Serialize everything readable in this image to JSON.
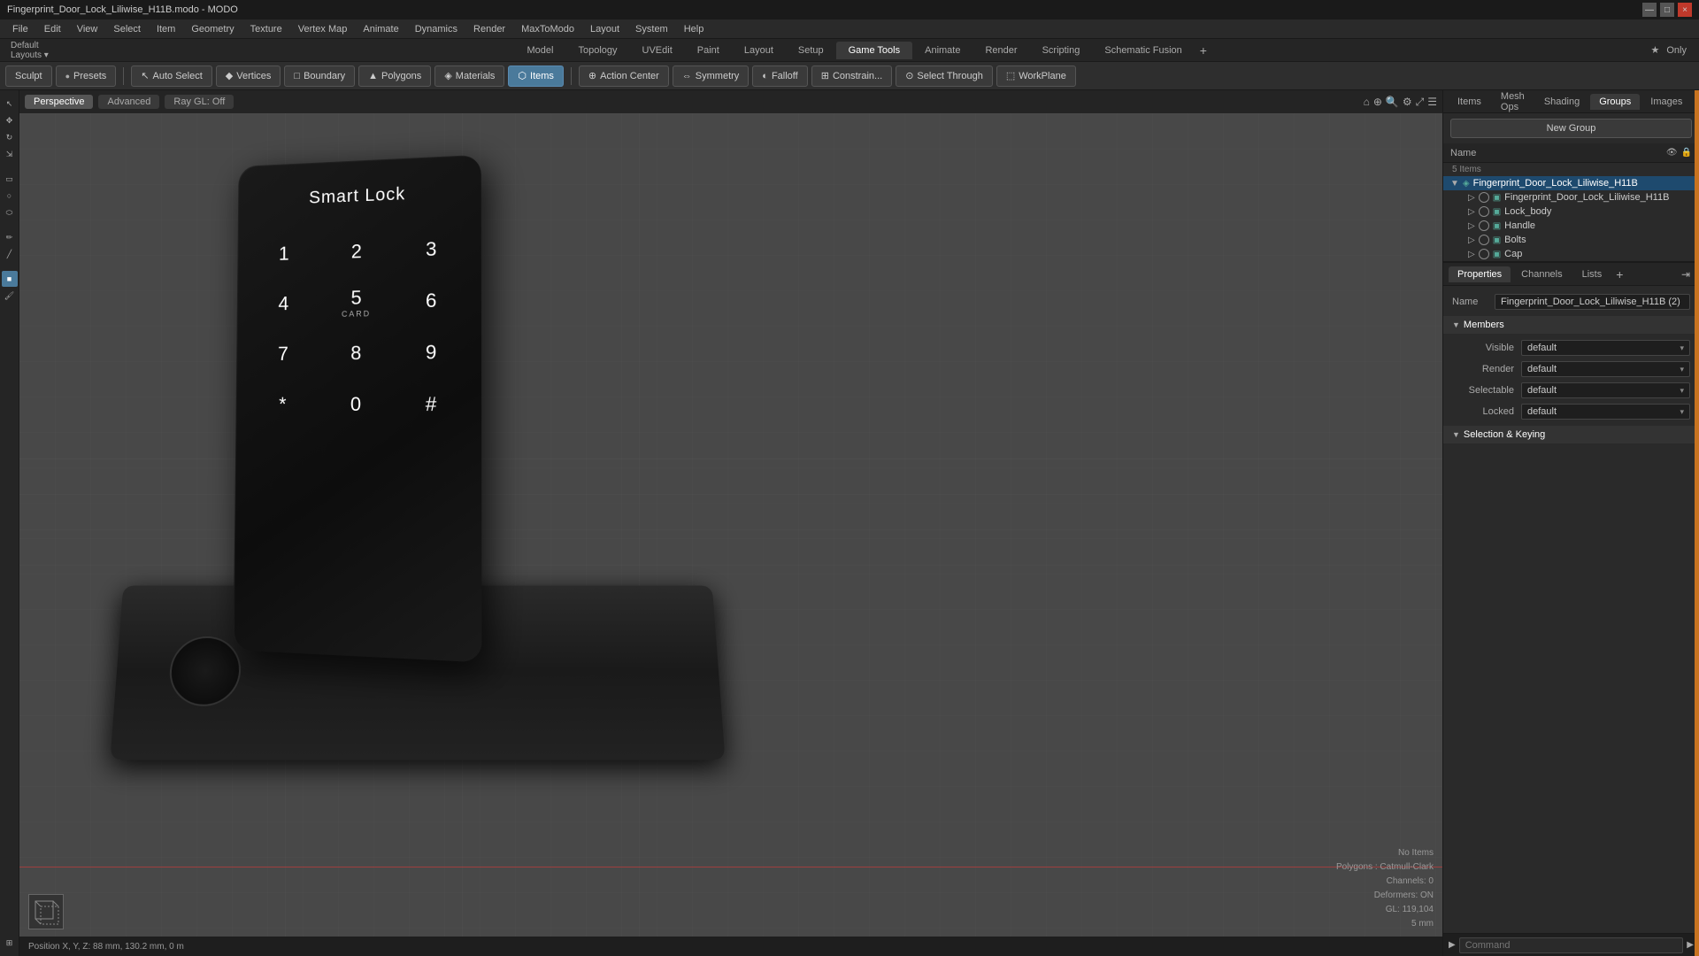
{
  "titlebar": {
    "title": "Fingerprint_Door_Lock_Liliwise_H11B.modo - MODO",
    "controls": [
      "—",
      "□",
      "×"
    ]
  },
  "menubar": {
    "items": [
      "File",
      "Edit",
      "View",
      "Select",
      "Item",
      "Geometry",
      "Texture",
      "Vertex Map",
      "Animate",
      "Dynamics",
      "Render",
      "MaxToModo",
      "Layout",
      "System",
      "Help"
    ]
  },
  "tabbar": {
    "tabs": [
      "Model",
      "Topology",
      "UVEdit",
      "Paint",
      "Layout",
      "Setup",
      "Game Tools",
      "Animate",
      "Render",
      "Scripting",
      "Schematic Fusion"
    ],
    "active": "Model",
    "right": "Only",
    "plus": "+"
  },
  "toolbar": {
    "sculpt": "Sculpt",
    "presets": "Presets",
    "auto_select": "Auto Select",
    "vertices": "Vertices",
    "boundary": "Boundary",
    "polygons": "Polygons",
    "materials": "Materials",
    "items": "Items",
    "action_center": "Action Center",
    "symmetry": "Symmetry",
    "falloff": "Falloff",
    "constrain": "Constrain...",
    "select_through": "Select Through",
    "workplane": "WorkPlane"
  },
  "viewport": {
    "tabs": [
      "Perspective",
      "Advanced",
      "Ray GL: Off"
    ],
    "active_tab": "Perspective",
    "position": "Position X, Y, Z:  88 mm, 130.2 mm, 0 m",
    "info": {
      "no_items": "No Items",
      "polygons": "Polygons : Catmull-Clark",
      "channels": "Channels: 0",
      "deformers": "Deformers: ON",
      "gl": "GL: 119,104",
      "mm": "5 mm"
    }
  },
  "lock_model": {
    "title": "Smart Lock",
    "keypad": [
      {
        "key": "1",
        "sub": ""
      },
      {
        "key": "2",
        "sub": ""
      },
      {
        "key": "3",
        "sub": ""
      },
      {
        "key": "4",
        "sub": ""
      },
      {
        "key": "5",
        "sub": "CARD"
      },
      {
        "key": "6",
        "sub": ""
      },
      {
        "key": "7",
        "sub": ""
      },
      {
        "key": "8",
        "sub": ""
      },
      {
        "key": "9",
        "sub": ""
      },
      {
        "key": "*",
        "sub": ""
      },
      {
        "key": "0",
        "sub": ""
      },
      {
        "key": "#",
        "sub": ""
      }
    ]
  },
  "right_panel": {
    "tabs": [
      "Items",
      "Mesh Ops",
      "Shading",
      "Groups",
      "Images"
    ],
    "active_tab": "Groups",
    "new_group": "New Group",
    "tree_header": "Name",
    "items_count": "5 Items",
    "scene_tree": [
      {
        "label": "Fingerprint_Door_Lock_Liliwise_H11B",
        "level": 0,
        "selected": true,
        "type": "group"
      },
      {
        "label": "Fingerprint_Door_Lock_Liliwise_H11B",
        "level": 1,
        "selected": false,
        "type": "mesh"
      },
      {
        "label": "Lock_body",
        "level": 1,
        "selected": false,
        "type": "mesh"
      },
      {
        "label": "Handle",
        "level": 1,
        "selected": false,
        "type": "mesh"
      },
      {
        "label": "Bolts",
        "level": 1,
        "selected": false,
        "type": "mesh"
      },
      {
        "label": "Cap",
        "level": 1,
        "selected": false,
        "type": "mesh"
      }
    ],
    "props_tabs": [
      "Properties",
      "Channels",
      "Lists"
    ],
    "props_active": "Properties",
    "name_label": "Name",
    "name_value": "Fingerprint_Door_Lock_Liliwise_H11B (2)",
    "members_section": "Members",
    "props": [
      {
        "label": "Visible",
        "value": "default"
      },
      {
        "label": "Render",
        "value": "default"
      },
      {
        "label": "Selectable",
        "value": "default"
      },
      {
        "label": "Locked",
        "value": "default"
      }
    ],
    "selection_section": "Selection & Keying",
    "command_placeholder": "Command"
  }
}
